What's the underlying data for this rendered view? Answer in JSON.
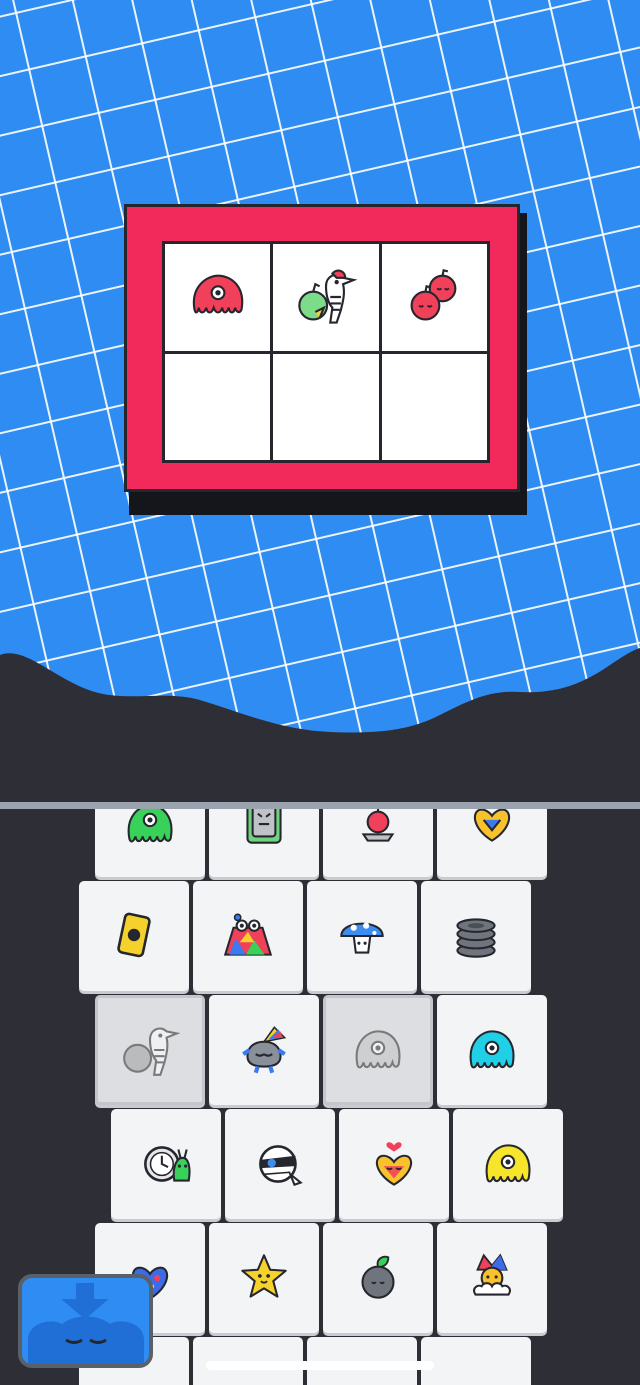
{
  "board": {
    "rows": 2,
    "cols": 3,
    "frame_color": "#f2295b",
    "grid_color": "#2f8cf2",
    "slots": [
      "red-jellyfish-icon",
      "woodpecker-apple-icon",
      "red-apples-icon",
      "",
      "",
      ""
    ]
  },
  "tray": {
    "tiles": [
      {
        "name": "green-blob-icon",
        "state": "available"
      },
      {
        "name": "robot-face-icon",
        "state": "available"
      },
      {
        "name": "sliced-apple-icon",
        "state": "available"
      },
      {
        "name": "fox-heart-icon",
        "state": "available"
      },
      {
        "name": "yellow-card-icon",
        "state": "available"
      },
      {
        "name": "rainbow-owl-icon",
        "state": "available"
      },
      {
        "name": "mushroom-icon",
        "state": "available"
      },
      {
        "name": "stone-stack-icon",
        "state": "available"
      },
      {
        "name": "woodpecker-apple-icon",
        "state": "used"
      },
      {
        "name": "rainbow-bird-icon",
        "state": "available"
      },
      {
        "name": "gray-jellyfish-icon",
        "state": "used"
      },
      {
        "name": "cyan-jellyfish-icon",
        "state": "available"
      },
      {
        "name": "clock-snail-icon",
        "state": "available"
      },
      {
        "name": "mummy-head-icon",
        "state": "available"
      },
      {
        "name": "heart-fox-icon",
        "state": "available"
      },
      {
        "name": "yellow-jellyfish-icon",
        "state": "available"
      },
      {
        "name": "blue-heart-creature-icon",
        "state": "available"
      },
      {
        "name": "star-creature-icon",
        "state": "available"
      },
      {
        "name": "gray-apple-icon",
        "state": "available"
      },
      {
        "name": "jester-cloud-icon",
        "state": "available"
      }
    ]
  },
  "controls": {
    "hint_button_icon": "download-arrow-sleeping-blob-icon"
  }
}
